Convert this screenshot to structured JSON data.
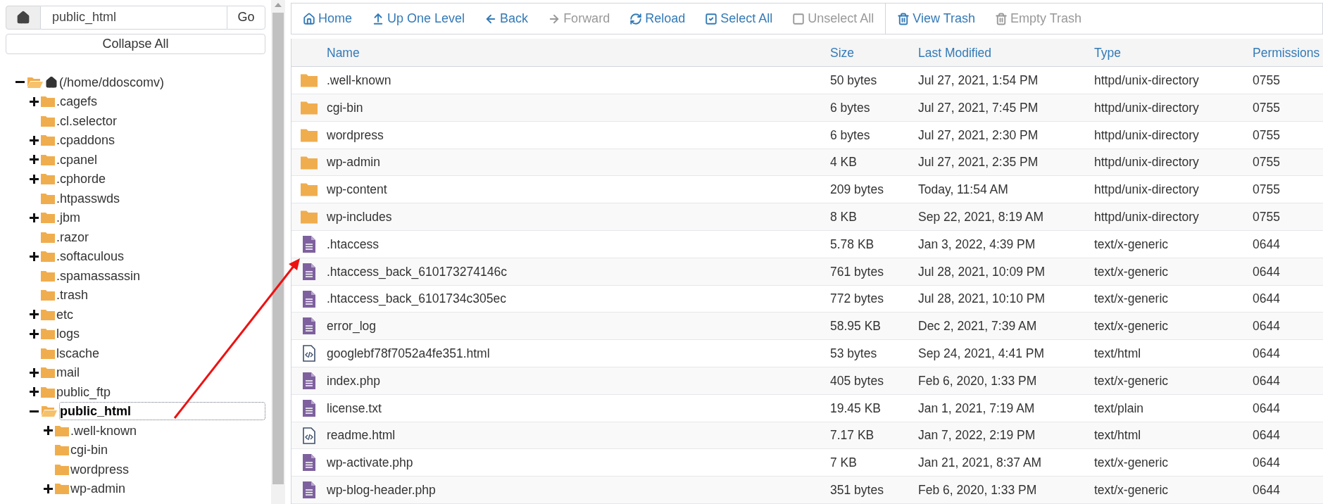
{
  "path_bar": {
    "value": "public_html",
    "go": "Go"
  },
  "collapse_all": "Collapse All",
  "tree": {
    "name": "(/home/ddoscomv)",
    "expandable": true,
    "expanded": true,
    "selected": false,
    "children": [
      {
        "name": ".cagefs",
        "expandable": true,
        "expanded": false,
        "selected": false
      },
      {
        "name": ".cl.selector",
        "expandable": false,
        "expanded": false,
        "selected": false
      },
      {
        "name": ".cpaddons",
        "expandable": true,
        "expanded": false,
        "selected": false
      },
      {
        "name": ".cpanel",
        "expandable": true,
        "expanded": false,
        "selected": false
      },
      {
        "name": ".cphorde",
        "expandable": true,
        "expanded": false,
        "selected": false
      },
      {
        "name": ".htpasswds",
        "expandable": false,
        "expanded": false,
        "selected": false
      },
      {
        "name": ".jbm",
        "expandable": true,
        "expanded": false,
        "selected": false
      },
      {
        "name": ".razor",
        "expandable": false,
        "expanded": false,
        "selected": false
      },
      {
        "name": ".softaculous",
        "expandable": true,
        "expanded": false,
        "selected": false
      },
      {
        "name": ".spamassassin",
        "expandable": false,
        "expanded": false,
        "selected": false
      },
      {
        "name": ".trash",
        "expandable": false,
        "expanded": false,
        "selected": false
      },
      {
        "name": "etc",
        "expandable": true,
        "expanded": false,
        "selected": false
      },
      {
        "name": "logs",
        "expandable": true,
        "expanded": false,
        "selected": false
      },
      {
        "name": "lscache",
        "expandable": false,
        "expanded": false,
        "selected": false
      },
      {
        "name": "mail",
        "expandable": true,
        "expanded": false,
        "selected": false
      },
      {
        "name": "public_ftp",
        "expandable": true,
        "expanded": false,
        "selected": false
      },
      {
        "name": "public_html",
        "expandable": true,
        "expanded": true,
        "selected": true,
        "children": [
          {
            "name": ".well-known",
            "expandable": true,
            "expanded": false,
            "selected": false
          },
          {
            "name": "cgi-bin",
            "expandable": false,
            "expanded": false,
            "selected": false
          },
          {
            "name": "wordpress",
            "expandable": false,
            "expanded": false,
            "selected": false
          },
          {
            "name": "wp-admin",
            "expandable": true,
            "expanded": false,
            "selected": false
          }
        ]
      }
    ]
  },
  "toolbar": [
    [
      {
        "label": "Home",
        "disabled": false
      },
      {
        "label": "Up One Level",
        "disabled": false
      },
      {
        "label": "Back",
        "disabled": false
      },
      {
        "label": "Forward",
        "disabled": true
      },
      {
        "label": "Reload",
        "disabled": false
      },
      {
        "label": "Select All",
        "disabled": false
      },
      {
        "label": "Unselect All",
        "disabled": true
      }
    ],
    [
      {
        "label": "View Trash",
        "disabled": false
      },
      {
        "label": "Empty Trash",
        "disabled": true
      }
    ]
  ],
  "table": {
    "columns": [
      "Name",
      "Size",
      "Last Modified",
      "Type",
      "Permissions"
    ],
    "rows": [
      {
        "kind": "folder",
        "cells": [
          ".well-known",
          "50 bytes",
          "Jul 27, 2021, 1:54 PM",
          "httpd/unix-directory",
          "0755"
        ]
      },
      {
        "kind": "folder",
        "cells": [
          "cgi-bin",
          "6 bytes",
          "Jul 27, 2021, 7:45 PM",
          "httpd/unix-directory",
          "0755"
        ]
      },
      {
        "kind": "folder",
        "cells": [
          "wordpress",
          "6 bytes",
          "Jul 27, 2021, 2:30 PM",
          "httpd/unix-directory",
          "0755"
        ]
      },
      {
        "kind": "folder",
        "cells": [
          "wp-admin",
          "4 KB",
          "Jul 27, 2021, 2:35 PM",
          "httpd/unix-directory",
          "0755"
        ]
      },
      {
        "kind": "folder",
        "cells": [
          "wp-content",
          "209 bytes",
          "Today, 11:54 AM",
          "httpd/unix-directory",
          "0755"
        ]
      },
      {
        "kind": "folder",
        "cells": [
          "wp-includes",
          "8 KB",
          "Sep 22, 2021, 8:19 AM",
          "httpd/unix-directory",
          "0755"
        ]
      },
      {
        "kind": "text",
        "cells": [
          ".htaccess",
          "5.78 KB",
          "Jan 3, 2022, 4:39 PM",
          "text/x-generic",
          "0644"
        ]
      },
      {
        "kind": "text",
        "cells": [
          ".htaccess_back_610173274146c",
          "761 bytes",
          "Jul 28, 2021, 10:09 PM",
          "text/x-generic",
          "0644"
        ]
      },
      {
        "kind": "text",
        "cells": [
          ".htaccess_back_6101734c305ec",
          "772 bytes",
          "Jul 28, 2021, 10:10 PM",
          "text/x-generic",
          "0644"
        ]
      },
      {
        "kind": "text",
        "cells": [
          "error_log",
          "58.95 KB",
          "Dec 2, 2021, 7:39 AM",
          "text/x-generic",
          "0644"
        ]
      },
      {
        "kind": "code",
        "cells": [
          "googlebf78f7052a4fe351.html",
          "53 bytes",
          "Sep 24, 2021, 4:41 PM",
          "text/html",
          "0644"
        ]
      },
      {
        "kind": "text",
        "cells": [
          "index.php",
          "405 bytes",
          "Feb 6, 2020, 1:33 PM",
          "text/x-generic",
          "0644"
        ]
      },
      {
        "kind": "text",
        "cells": [
          "license.txt",
          "19.45 KB",
          "Jan 1, 2021, 7:19 AM",
          "text/plain",
          "0644"
        ]
      },
      {
        "kind": "code",
        "cells": [
          "readme.html",
          "7.17 KB",
          "Jan 7, 2022, 2:19 PM",
          "text/html",
          "0644"
        ]
      },
      {
        "kind": "text",
        "cells": [
          "wp-activate.php",
          "7 KB",
          "Jan 21, 2021, 8:37 AM",
          "text/x-generic",
          "0644"
        ]
      },
      {
        "kind": "text",
        "cells": [
          "wp-blog-header.php",
          "351 bytes",
          "Feb 6, 2020, 1:33 PM",
          "text/x-generic",
          "0644"
        ]
      }
    ]
  }
}
